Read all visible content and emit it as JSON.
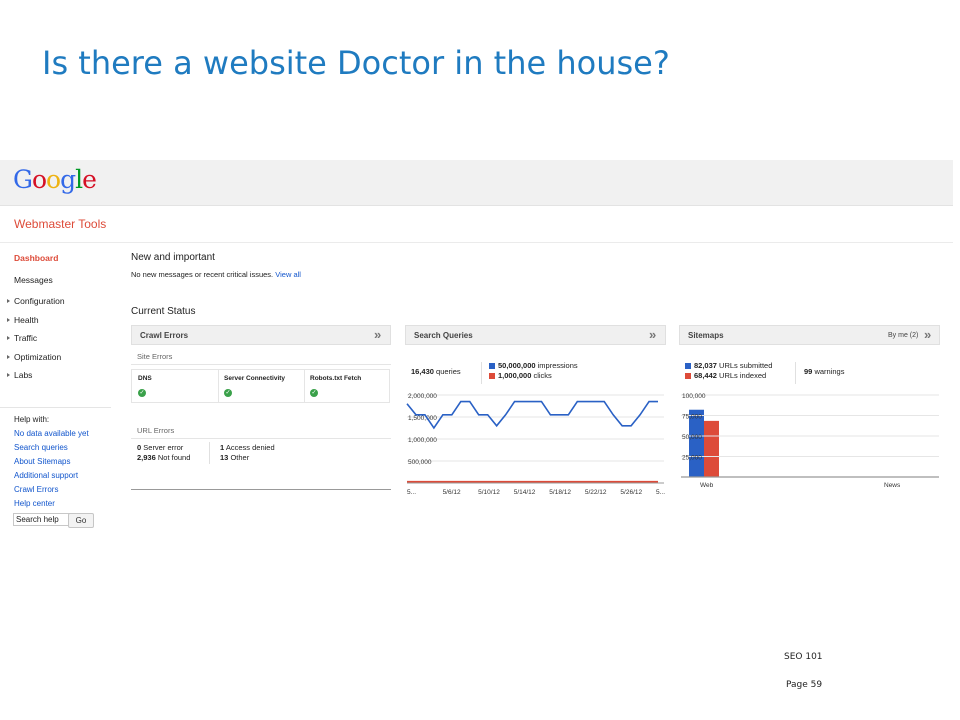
{
  "slide": {
    "title": "Is there a website Doctor in the house?",
    "footer": "SEO 101",
    "page": "Page 59"
  },
  "logo": {
    "letters": [
      "G",
      "o",
      "o",
      "g",
      "l",
      "e"
    ],
    "colors": [
      "#3369e8",
      "#d50f25",
      "#eeb211",
      "#3369e8",
      "#009925",
      "#d50f25"
    ]
  },
  "product_title": "Webmaster Tools",
  "sidebar": {
    "items": [
      {
        "label": "Dashboard",
        "active": true,
        "caret": false
      },
      {
        "label": "Messages",
        "active": false,
        "caret": false
      },
      {
        "label": "Configuration",
        "active": false,
        "caret": true
      },
      {
        "label": "Health",
        "active": false,
        "caret": true
      },
      {
        "label": "Traffic",
        "active": false,
        "caret": true
      },
      {
        "label": "Optimization",
        "active": false,
        "caret": true
      },
      {
        "label": "Labs",
        "active": false,
        "caret": true
      }
    ],
    "help": {
      "title": "Help with:",
      "links": [
        "No data available yet",
        "Search queries",
        "About Sitemaps",
        "Additional support",
        "Crawl Errors",
        "Help center"
      ],
      "search_value": "Search help",
      "go_label": "Go"
    }
  },
  "main": {
    "new_title": "New and important",
    "notice_text": "No new messages or recent critical issues.",
    "notice_link": "View all",
    "status_title": "Current Status"
  },
  "crawl": {
    "title": "Crawl Errors",
    "chevron": "»",
    "site_errors_label": "Site Errors",
    "columns": [
      "DNS",
      "Server Connectivity",
      "Robots.txt Fetch"
    ],
    "check_glyph": "✓",
    "url_errors_label": "URL Errors",
    "stats_left": [
      {
        "value": "0",
        "label": "Server error"
      },
      {
        "value": "2,936",
        "label": "Not found"
      }
    ],
    "stats_right": [
      {
        "value": "1",
        "label": "Access denied"
      },
      {
        "value": "13",
        "label": "Other"
      }
    ]
  },
  "queries": {
    "title": "Search Queries",
    "chevron": "»",
    "count_value": "16,430",
    "count_label": "queries",
    "legend": [
      {
        "value": "50,000,000",
        "label": "impressions",
        "color": "#2a61c5"
      },
      {
        "value": "1,000,000",
        "label": "clicks",
        "color": "#dd4b39"
      }
    ]
  },
  "sitemaps": {
    "title": "Sitemaps",
    "by_me": "By me (2)",
    "chevron": "»",
    "legend": [
      {
        "value": "82,037",
        "label": "URLs submitted",
        "color": "#2a61c5"
      },
      {
        "value": "68,442",
        "label": "URLs indexed",
        "color": "#dd4b39"
      }
    ],
    "warnings_value": "99",
    "warnings_label": "warnings"
  },
  "chart_data": [
    {
      "type": "line",
      "x": [
        "5...",
        "5/6/12",
        "5/10/12",
        "5/14/12",
        "5/18/12",
        "5/22/12",
        "5/26/12",
        "5..."
      ],
      "y_ticks": [
        "2,000,000",
        "1,500,000",
        "1,000,000",
        "500,000"
      ],
      "ylim": [
        0,
        2000000
      ],
      "series": [
        {
          "values": [
            1800000,
            1550000,
            1550000,
            1250000,
            1550000,
            1550000,
            1850000,
            1850000,
            1550000,
            1550000,
            1300000,
            1550000,
            1850000,
            1850000,
            1850000,
            1850000,
            1550000,
            1550000,
            1550000,
            1850000,
            1850000,
            1850000,
            1850000,
            1550000,
            1300000,
            1300000,
            1550000,
            1850000,
            1850000
          ],
          "color": "#2a61c5"
        },
        {
          "values": [
            30000,
            30000,
            30000,
            30000,
            30000,
            30000,
            30000,
            30000,
            30000,
            30000,
            30000,
            30000,
            30000,
            30000,
            30000,
            30000,
            30000,
            30000,
            30000,
            30000,
            30000,
            30000,
            30000,
            30000,
            30000,
            30000,
            30000,
            30000,
            30000
          ],
          "color": "#dd4b39"
        }
      ],
      "grid": true
    },
    {
      "type": "bar",
      "categories": [
        "Web",
        "News"
      ],
      "y_ticks": [
        "100,000",
        "75,000",
        "50,000",
        "25,000"
      ],
      "ylim": [
        0,
        100000
      ],
      "series": [
        {
          "name": "URLs submitted",
          "values": [
            82037,
            0
          ],
          "color": "#2a61c5"
        },
        {
          "name": "URLs indexed",
          "values": [
            68442,
            0
          ],
          "color": "#dd4b39"
        }
      ],
      "grid": true
    }
  ]
}
